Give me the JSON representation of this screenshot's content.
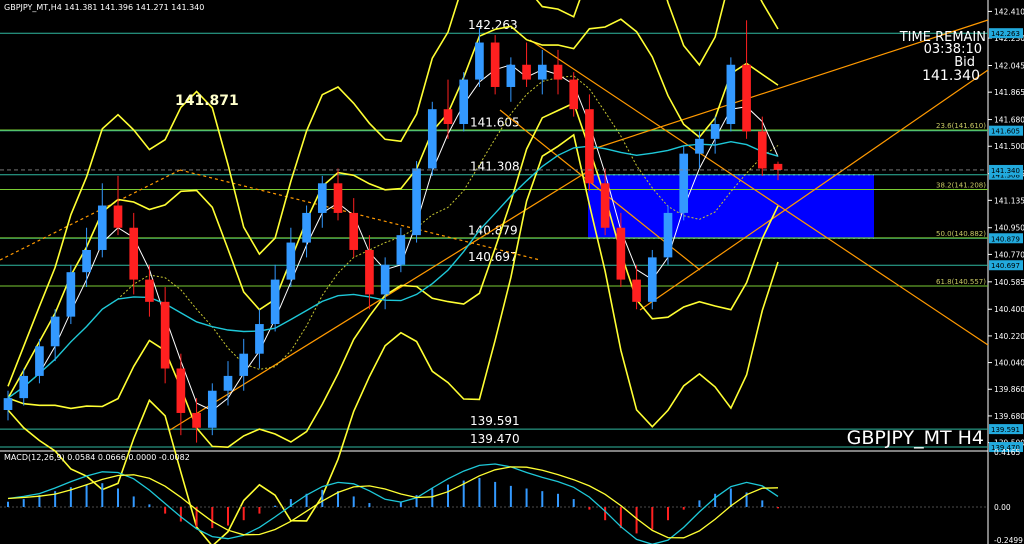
{
  "header": {
    "main_info": "GBPJPY_MT,H4  141.381 141.396 141.271 141.340",
    "macd_info": "MACD(12,26,9) 0.0584 0.0666 0.0000 -0.0082"
  },
  "overlay": {
    "time_remain_label": "TIME REMAIN",
    "time_remain_value": "03:38:10",
    "bid_label": "Bid",
    "bid_value": "141.340",
    "symbol_caption": "GBPJPY_MT H4",
    "big_level": "141.871"
  },
  "colors": {
    "background": "#000000",
    "bull": "#3399ff",
    "bear": "#ff2020",
    "bollinger": "#ffff33",
    "fast_ma": "#ffffff",
    "slow_ma": "#1ec8d8",
    "hline": "#33cc88",
    "trendline": "#ff9900",
    "zone": "#0000ff",
    "macd_line": "#1ec8d8",
    "signal_line": "#ffff33"
  },
  "chart_data": {
    "type": "candlestick",
    "symbol": "GBPJPY_MT",
    "timeframe": "H4",
    "ylim": [
      139.45,
      142.46
    ],
    "y_ticks": [
      "142.410",
      "142.230",
      "142.045",
      "141.865",
      "141.680",
      "141.500",
      "141.315",
      "141.135",
      "140.950",
      "140.770",
      "140.585",
      "140.400",
      "140.220",
      "140.040",
      "139.860",
      "139.680",
      "139.500"
    ],
    "candles": [
      [
        139.72,
        139.85,
        139.65,
        139.8
      ],
      [
        139.8,
        140.0,
        139.75,
        139.95
      ],
      [
        139.95,
        140.2,
        139.9,
        140.15
      ],
      [
        140.15,
        140.4,
        140.05,
        140.35
      ],
      [
        140.35,
        140.7,
        140.3,
        140.65
      ],
      [
        140.65,
        140.95,
        140.55,
        140.8
      ],
      [
        140.8,
        141.25,
        140.75,
        141.1
      ],
      [
        141.1,
        141.3,
        140.9,
        140.95
      ],
      [
        140.95,
        141.05,
        140.5,
        140.6
      ],
      [
        140.6,
        140.7,
        140.35,
        140.45
      ],
      [
        140.45,
        140.55,
        139.9,
        140.0
      ],
      [
        140.0,
        140.1,
        139.55,
        139.7
      ],
      [
        139.7,
        139.8,
        139.5,
        139.6
      ],
      [
        139.6,
        139.9,
        139.55,
        139.85
      ],
      [
        139.85,
        140.05,
        139.75,
        139.95
      ],
      [
        139.95,
        140.2,
        139.85,
        140.1
      ],
      [
        140.1,
        140.4,
        140.0,
        140.3
      ],
      [
        140.3,
        140.7,
        140.25,
        140.6
      ],
      [
        140.6,
        140.95,
        140.55,
        140.85
      ],
      [
        140.85,
        141.1,
        140.75,
        141.05
      ],
      [
        141.05,
        141.3,
        140.95,
        141.25
      ],
      [
        141.25,
        141.35,
        141.0,
        141.05
      ],
      [
        141.05,
        141.15,
        140.75,
        140.8
      ],
      [
        140.8,
        140.9,
        140.4,
        140.5
      ],
      [
        140.5,
        140.75,
        140.4,
        140.7
      ],
      [
        140.7,
        140.95,
        140.65,
        140.9
      ],
      [
        140.9,
        141.4,
        140.85,
        141.35
      ],
      [
        141.35,
        141.8,
        141.3,
        141.75
      ],
      [
        141.75,
        141.95,
        141.55,
        141.65
      ],
      [
        141.65,
        142.0,
        141.6,
        141.95
      ],
      [
        141.95,
        142.3,
        141.9,
        142.2
      ],
      [
        142.2,
        142.25,
        141.85,
        141.9
      ],
      [
        141.9,
        142.1,
        141.8,
        142.05
      ],
      [
        142.05,
        142.2,
        141.9,
        141.95
      ],
      [
        141.95,
        142.15,
        141.85,
        142.05
      ],
      [
        142.05,
        142.15,
        141.85,
        141.95
      ],
      [
        141.95,
        142.0,
        141.7,
        141.75
      ],
      [
        141.75,
        141.85,
        141.2,
        141.25
      ],
      [
        141.25,
        141.35,
        140.9,
        140.95
      ],
      [
        140.95,
        141.05,
        140.55,
        140.6
      ],
      [
        140.6,
        140.7,
        140.4,
        140.45
      ],
      [
        140.45,
        140.8,
        140.4,
        140.75
      ],
      [
        140.75,
        141.1,
        140.7,
        141.05
      ],
      [
        141.05,
        141.5,
        141.0,
        141.45
      ],
      [
        141.45,
        141.6,
        141.35,
        141.55
      ],
      [
        141.55,
        141.7,
        141.45,
        141.65
      ],
      [
        141.65,
        142.1,
        141.6,
        142.05
      ],
      [
        142.05,
        142.35,
        141.55,
        141.6
      ],
      [
        141.6,
        141.7,
        141.3,
        141.35
      ],
      [
        141.381,
        141.396,
        141.271,
        141.34
      ]
    ],
    "horizontal_levels": [
      {
        "label": "142.263",
        "value": 142.263
      },
      {
        "label": "141.605",
        "value": 141.605
      },
      {
        "label": "141.308",
        "value": 141.308
      },
      {
        "label": "140.879",
        "value": 140.879
      },
      {
        "label": "140.697",
        "value": 140.697
      },
      {
        "label": "139.591",
        "value": 139.591
      },
      {
        "label": "139.470",
        "value": 139.47
      }
    ],
    "fib_levels": [
      {
        "label": "23.6(141.610)",
        "value": 141.61
      },
      {
        "label": "38.2(141.208)",
        "value": 141.208
      },
      {
        "label": "50.0(140.882)",
        "value": 140.882
      },
      {
        "label": "61.8(140.557)",
        "value": 140.557
      }
    ],
    "current_price": {
      "label": "141.340",
      "value": 141.34
    },
    "zone": {
      "from": 140.879,
      "to": 141.308
    },
    "macd": {
      "label": "MACD(12,26,9)",
      "main": 0.0584,
      "signal": 0.0666,
      "hist": -0.0082,
      "ylim": [
        -0.2499,
        0.4165
      ],
      "y_ticks": [
        "0.4165",
        "0.00",
        "-0.2499"
      ],
      "histogram": [
        0.04,
        0.06,
        0.09,
        0.12,
        0.15,
        0.17,
        0.18,
        0.14,
        0.08,
        0.02,
        -0.05,
        -0.11,
        -0.15,
        -0.16,
        -0.14,
        -0.1,
        -0.05,
        0.01,
        0.06,
        0.1,
        0.13,
        0.12,
        0.08,
        0.03,
        0.0,
        0.04,
        0.09,
        0.14,
        0.17,
        0.2,
        0.22,
        0.19,
        0.16,
        0.14,
        0.12,
        0.1,
        0.06,
        -0.02,
        -0.1,
        -0.16,
        -0.2,
        -0.17,
        -0.1,
        -0.02,
        0.05,
        0.1,
        0.14,
        0.11,
        0.05,
        -0.01
      ]
    }
  }
}
